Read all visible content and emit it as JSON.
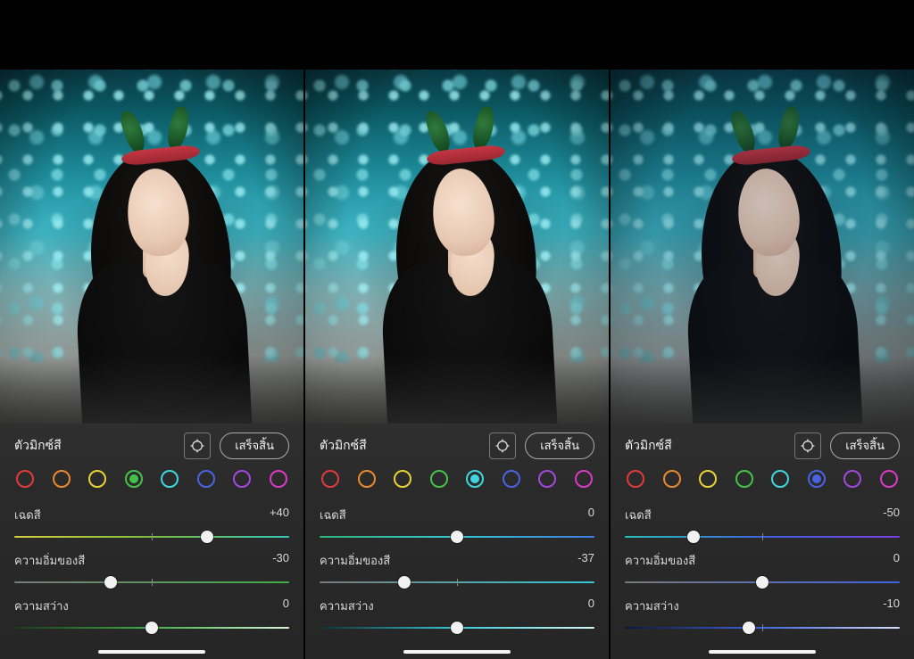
{
  "app": {
    "section_title": "ตัวมิกซ์สี",
    "done_label": "เสร็จสิ้น"
  },
  "swatch_colors": [
    {
      "id": "red",
      "hex": "#e23b3b"
    },
    {
      "id": "orange",
      "hex": "#e98a2e"
    },
    {
      "id": "yellow",
      "hex": "#e8d234"
    },
    {
      "id": "green",
      "hex": "#45c24a"
    },
    {
      "id": "aqua",
      "hex": "#3fd6dd"
    },
    {
      "id": "blue",
      "hex": "#4a63e0"
    },
    {
      "id": "purple",
      "hex": "#a248e0"
    },
    {
      "id": "magenta",
      "hex": "#d93bc2"
    }
  ],
  "slider_labels": {
    "hue": "เฉดสี",
    "saturation": "ความอิ่มของสี",
    "luminance": "ความสว่าง"
  },
  "panels": [
    {
      "selected_swatch": "green",
      "photo_tint": "rgba(0,0,0,0)",
      "sliders": {
        "hue": {
          "value_text": "+40",
          "pos": 70,
          "grad": [
            "#d8cf3e",
            "#7bbf3e",
            "#35c7b8"
          ],
          "mid": 50
        },
        "saturation": {
          "value_text": "-30",
          "pos": 35,
          "grad": [
            "#7a7a7a",
            "#3fae46"
          ],
          "mid": 50
        },
        "luminance": {
          "value_text": "0",
          "pos": 50,
          "grad": [
            "#1b3a1b",
            "#3fae46",
            "#d7f5d7"
          ],
          "mid": 50
        }
      }
    },
    {
      "selected_swatch": "aqua",
      "photo_tint": "rgba(0,0,0,0)",
      "sliders": {
        "hue": {
          "value_text": "0",
          "pos": 50,
          "grad": [
            "#2fb87a",
            "#34c8d4",
            "#3f7de0"
          ],
          "mid": 50
        },
        "saturation": {
          "value_text": "-37",
          "pos": 31,
          "grad": [
            "#7a7a7a",
            "#34c8d4"
          ],
          "mid": 50
        },
        "luminance": {
          "value_text": "0",
          "pos": 50,
          "grad": [
            "#0f3036",
            "#34c8d4",
            "#d6f7fa"
          ],
          "mid": 50
        }
      }
    },
    {
      "selected_swatch": "blue",
      "photo_tint": "rgba(10,30,55,0.18)",
      "sliders": {
        "hue": {
          "value_text": "-50",
          "pos": 25,
          "grad": [
            "#27c1bc",
            "#3f63e0",
            "#7a3fe0"
          ],
          "mid": 50
        },
        "saturation": {
          "value_text": "0",
          "pos": 50,
          "grad": [
            "#7a7a7a",
            "#3f63e0"
          ],
          "mid": 50
        },
        "luminance": {
          "value_text": "-10",
          "pos": 45,
          "grad": [
            "#0c1640",
            "#3f63e0",
            "#d6defa"
          ],
          "mid": 50
        }
      }
    }
  ]
}
